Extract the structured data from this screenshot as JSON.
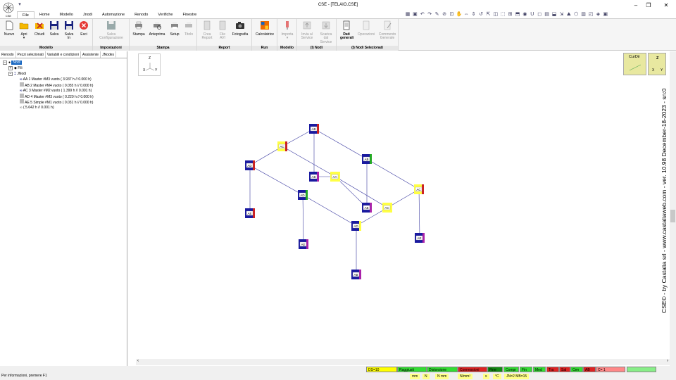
{
  "window": {
    "title": "CSE - [TELAIO.CSE]"
  },
  "tabs": [
    "File",
    "Home",
    "Modello",
    "Jnodi",
    "Automazione",
    "Renodo",
    "Verifiche",
    "Finestre"
  ],
  "ribbon": {
    "modello": {
      "label": "Modello",
      "buttons": [
        "Nuovo",
        "Apri",
        "Chiudi",
        "Salva",
        "Salva In",
        "Esci"
      ]
    },
    "impostazioni": {
      "label": "Impostazioni",
      "buttons": [
        "Salva Configurazione"
      ]
    },
    "stampa": {
      "label": "Stampa",
      "buttons": [
        "Stampa",
        "Anteprima",
        "Setup",
        "Titolo"
      ]
    },
    "report": {
      "label": "Report",
      "buttons": [
        "Crea Report",
        "File AVI",
        "Fotografia"
      ]
    },
    "run": {
      "label": "Run",
      "buttons": [
        "Calcolatrice"
      ]
    },
    "modello2": {
      "label": "Modello",
      "buttons": [
        "Importa"
      ]
    },
    "nodi": {
      "label": "(I) Nodi",
      "buttons": [
        "Invia al Service",
        "Scarica dal Service"
      ]
    },
    "nodisel": {
      "label": "(I) Nodi Selezionati",
      "buttons": [
        "Dati generali",
        "Operazioni",
        "Commento Generale"
      ]
    }
  },
  "panel_tabs": [
    "Renodo",
    "Pezzi selezionati",
    "Variabili e condizioni",
    "Assistente",
    "JNodes"
  ],
  "tree": {
    "root": "Nodi",
    "fili": "Fili",
    "jnodi": "JNodi",
    "items": [
      "AA 1  Master  #M3 vuoto ( 3.937 h  //  0.000 h)",
      "AB 2  Master  #M4 vuoto ( 0.055 h  //  0.000 h)",
      "AC 3  Master  #M2 vuoto ( 1.399 h  //  0.001 h)",
      "AD 4  Master  #M3 vuoto ( 0.220 h  //  0.000 h)",
      "AE 5  Simple  #M1 vuoto ( 0.031 h  //  0.000 h)"
    ],
    "total": "( 5.642 h  //  0.001 h)"
  },
  "axes": {
    "z": "Z",
    "x": "X",
    "y": "Y",
    "curdir": "CurDir"
  },
  "watermark": "CSE© - by Castalia srl - www.castaliaweb.com - ver. 10.98 December-18-2023 - sn:0",
  "status": {
    "help": "Per informazioni, premere F1",
    "chips": [
      {
        "text": "DS=10",
        "color": "#ffff00"
      },
      {
        "text": "Raggiusti",
        "color": "#33dd33"
      },
      {
        "text": "Distorsione",
        "color": "#33dd33"
      },
      {
        "text": "Connessioni",
        "color": "#dd2222"
      },
      {
        "text": "Fine",
        "color": "#118811"
      },
      {
        "text": "Compr",
        "color": "#33dd33"
      },
      {
        "text": "Fin",
        "color": "#33dd33"
      },
      {
        "text": "Med",
        "color": "#33dd33"
      },
      {
        "text": "Tra",
        "color": "#dd2222"
      },
      {
        "text": "Sal",
        "color": "#dd2222"
      },
      {
        "text": "Cen",
        "color": "#33dd33"
      },
      {
        "text": "AB",
        "color": "#dd2222"
      },
      {
        "text": "C= 1",
        "color": "#ff8888"
      },
      {
        "text": "",
        "color": "#88ee88"
      }
    ],
    "units": [
      "mm",
      "N",
      "N mm",
      "N/mm²",
      "s",
      "°C",
      "JN=2 MB=15"
    ]
  },
  "nodes": [
    {
      "label": "AB"
    },
    {
      "label": "AC"
    },
    {
      "label": "AD"
    },
    {
      "label": "AB"
    },
    {
      "label": "AA"
    },
    {
      "label": "AB"
    },
    {
      "label": "AD"
    },
    {
      "label": "AC"
    },
    {
      "label": "AB"
    },
    {
      "label": "AC"
    },
    {
      "label": "AD"
    },
    {
      "label": "AE"
    },
    {
      "label": "AE"
    },
    {
      "label": "AE"
    },
    {
      "label": "AD"
    },
    {
      "label": "AB"
    }
  ]
}
